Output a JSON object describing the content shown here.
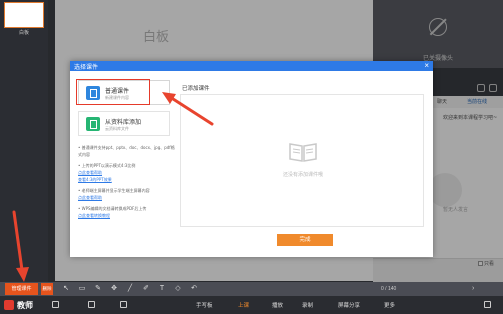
{
  "slides": {
    "thumb_label": "白板"
  },
  "canvas": {
    "title": "白板"
  },
  "right_panel": {
    "camera_label": "已关摄像头",
    "tabs": [
      "聊天",
      "当前在线"
    ],
    "chat_preview": "欢迎来到本课程学习吧~",
    "chat_empty": "暂无人发言",
    "checkbox_label": "只看",
    "page_count": "0 / 140"
  },
  "dialog": {
    "title": "选择课件",
    "close": "×",
    "options": [
      {
        "title": "普通课件",
        "subtitle": "新建课件内容"
      },
      {
        "title": "从资料库添加",
        "subtitle": "云资料库文件"
      }
    ],
    "notes": [
      {
        "text": "普通课件支持ppt、pptx、doc、docx、jpg、pdf格式内容",
        "link": ""
      },
      {
        "text": "上传的PPT以演示模式4:3比例",
        "link": "点此查看帮助"
      },
      {
        "text": "",
        "link": "查看4:3的PPT效果"
      },
      {
        "text": "老师端主屏幕并显示学生端主屏幕内容",
        "link": "点此查看帮助"
      },
      {
        "text": "WPS编辑的文档请转换成PDF后上传",
        "link": "点此查看转换教程"
      }
    ],
    "added_label": "已添加课件",
    "empty_hint": "还没有添加课件哦",
    "done_label": "完成"
  },
  "toolbar": {
    "manage_label": "管理课件",
    "prev_label": "删除",
    "page_count": "0 / 140"
  },
  "statusbar": {
    "logo": "教师",
    "items": [
      {
        "label": "手写板",
        "active": false
      },
      {
        "label": "上课",
        "active": true
      },
      {
        "label": "播放",
        "active": false
      },
      {
        "label": "录制",
        "active": false
      },
      {
        "label": "屏幕分享",
        "active": false
      },
      {
        "label": "更多",
        "active": false
      }
    ]
  },
  "colors": {
    "accent": "#f08a2c",
    "header_blue": "#2e7ae6",
    "highlight_red": "#e53a2a",
    "brand_red": "#e23b2f"
  }
}
